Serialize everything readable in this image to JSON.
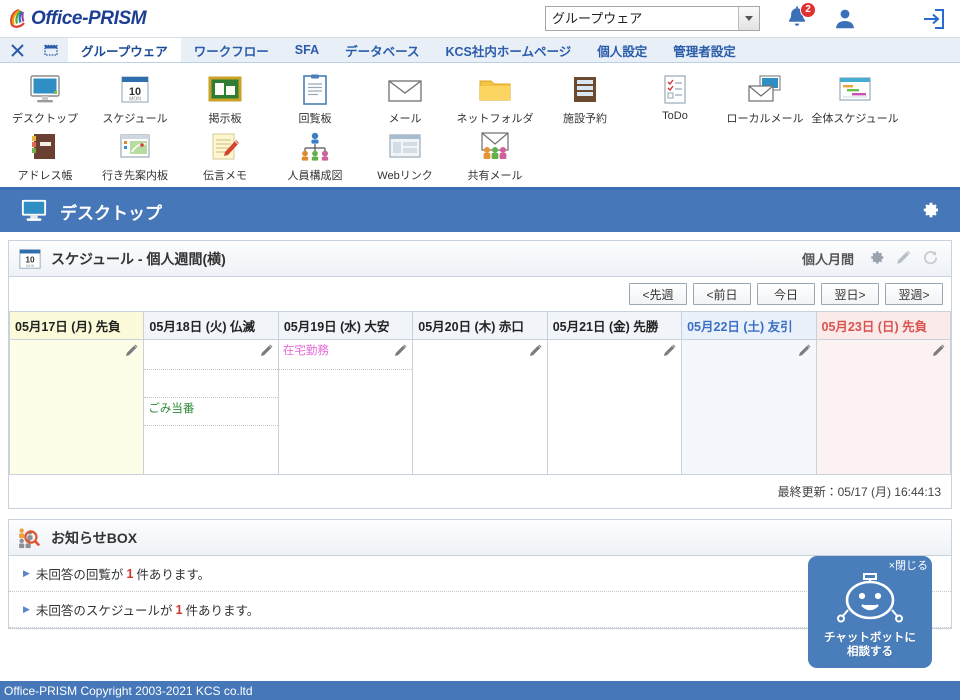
{
  "brand": {
    "name": "Office-PRISM"
  },
  "topbar": {
    "app_selector": {
      "value": "グループウェア",
      "options": [
        "グループウェア",
        "ワークフロー",
        "SFA"
      ]
    },
    "notification_count": "2",
    "icons": {
      "bell": "bell-icon",
      "user": "user-icon",
      "logout": "logout-icon"
    }
  },
  "tabbar": {
    "close_label": "✕",
    "tabs": [
      {
        "label": "グループウェア",
        "active": true
      },
      {
        "label": "ワークフロー",
        "active": false
      },
      {
        "label": "SFA",
        "active": false
      },
      {
        "label": "データベース",
        "active": false
      },
      {
        "label": "KCS社内ホームページ",
        "active": false
      },
      {
        "label": "個人設定",
        "active": false
      },
      {
        "label": "管理者設定",
        "active": false
      }
    ]
  },
  "iconmenu": {
    "row1": [
      {
        "label": "デスクトップ",
        "icon": "monitor-icon"
      },
      {
        "label": "スケジュール",
        "icon": "calendar-icon"
      },
      {
        "label": "掲示板",
        "icon": "bulletin-board-icon"
      },
      {
        "label": "回覧板",
        "icon": "clipboard-icon"
      },
      {
        "label": "メール",
        "icon": "envelope-icon"
      },
      {
        "label": "ネットフォルダ",
        "icon": "folder-icon"
      },
      {
        "label": "施設予約",
        "icon": "facility-icon"
      },
      {
        "label": "ToDo",
        "icon": "todo-list-icon"
      },
      {
        "label": "ローカルメール",
        "icon": "local-mail-icon"
      },
      {
        "label": "全体スケジュール",
        "icon": "gantt-icon"
      }
    ],
    "row2": [
      {
        "label": "アドレス帳",
        "icon": "address-book-icon"
      },
      {
        "label": "行き先案内板",
        "icon": "destination-board-icon"
      },
      {
        "label": "伝言メモ",
        "icon": "memo-pencil-icon"
      },
      {
        "label": "人員構成図",
        "icon": "org-chart-icon"
      },
      {
        "label": "Webリンク",
        "icon": "web-link-icon"
      },
      {
        "label": "共有メール",
        "icon": "shared-mail-icon"
      }
    ]
  },
  "page": {
    "title": "デスクトップ",
    "icon": "monitor-icon",
    "settings_icon": "gear-icon"
  },
  "schedule_panel": {
    "title": "スケジュール - 個人週間(横)",
    "icon": "calendar-icon",
    "mode_label": "個人月間",
    "tool_icons": [
      "gear-icon",
      "pencil-icon",
      "refresh-icon"
    ],
    "nav_buttons": [
      "<先週",
      "<前日",
      "今日",
      "翌日>",
      "翌週>"
    ],
    "days": [
      {
        "header": "05月17日 (月) 先負",
        "type": "mon",
        "events": [
          "",
          "",
          "",
          ""
        ]
      },
      {
        "header": "05月18日 (火) 仏滅",
        "type": "weekday",
        "events": [
          "",
          "",
          "ごみ当番",
          ""
        ]
      },
      {
        "header": "05月19日 (水) 大安",
        "type": "weekday",
        "events": [
          "在宅勤務",
          "",
          "",
          ""
        ]
      },
      {
        "header": "05月20日 (木) 赤口",
        "type": "weekday",
        "events": [
          "",
          "",
          "",
          ""
        ]
      },
      {
        "header": "05月21日 (金) 先勝",
        "type": "weekday",
        "events": [
          "",
          "",
          "",
          ""
        ]
      },
      {
        "header": "05月22日 (土) 友引",
        "type": "sat",
        "events": [
          "",
          "",
          "",
          ""
        ]
      },
      {
        "header": "05月23日 (日) 先負",
        "type": "sun",
        "events": [
          "",
          "",
          "",
          ""
        ]
      }
    ],
    "event_colors": {
      "在宅勤務": "#e56ad6",
      "ごみ当番": "#2e8b3a"
    },
    "last_update": "最終更新：05/17 (月) 16:44:13"
  },
  "notice_panel": {
    "title": "お知らせBOX",
    "icon": "people-search-icon",
    "rows": [
      {
        "pre": "未回答の回覧が",
        "count": "1",
        "post": "件あります。"
      },
      {
        "pre": "未回答のスケジュールが",
        "count": "1",
        "post": "件あります。"
      }
    ]
  },
  "chatbot": {
    "close_label": "×閉じる",
    "line1": "チャットボットに",
    "line2": "相談する",
    "icon": "robot-face-icon"
  },
  "footer": {
    "text": "Office-PRISM Copyright 2003-2021 KCS co.ltd"
  },
  "colors": {
    "brand_blue": "#1d3f91",
    "header_blue": "#4677b8",
    "tab_blue": "#2a5caa",
    "badge_red": "#e03030",
    "saturday": "#3b6fc4",
    "sunday": "#d9534f"
  }
}
